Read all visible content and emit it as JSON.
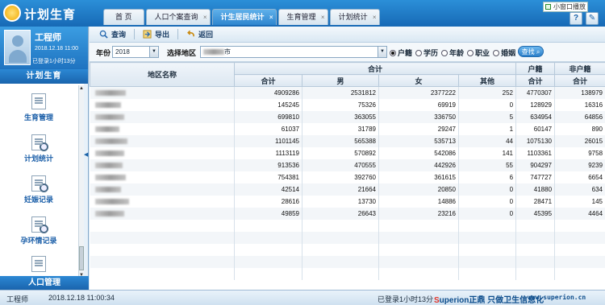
{
  "app": {
    "title": "计划生育"
  },
  "tabs": [
    {
      "label": "首 页",
      "closable": false,
      "active": false
    },
    {
      "label": "人口个案查询",
      "closable": true,
      "active": false
    },
    {
      "label": "计生居民统计",
      "closable": true,
      "active": true
    },
    {
      "label": "生育管理",
      "closable": true,
      "active": false
    },
    {
      "label": "计划统计",
      "closable": true,
      "active": false
    }
  ],
  "tab_close_glyph": "×",
  "popup": {
    "label": "小窗口播放"
  },
  "user": {
    "name": "工程师",
    "datetime": "2018.12.18 11:00",
    "login_duration": "已登录1小时13分"
  },
  "sidebar": {
    "section": "计划生育",
    "items": [
      {
        "label": "生育管理",
        "icon": "document-icon"
      },
      {
        "label": "计划统计",
        "icon": "document-search-icon"
      },
      {
        "label": "妊娠记录",
        "icon": "document-search-icon"
      },
      {
        "label": "孕环情记录",
        "icon": "document-search-icon"
      },
      {
        "label": "",
        "icon": "document-icon"
      }
    ],
    "footer": "人口管理"
  },
  "toolbar": {
    "query": "查询",
    "export": "导出",
    "back": "返回"
  },
  "filter": {
    "year_label": "年份",
    "year_value": "2018",
    "region_label": "选择地区",
    "region_value": "市",
    "radios": [
      {
        "label": "户籍",
        "checked": true
      },
      {
        "label": "学历",
        "checked": false
      },
      {
        "label": "年龄",
        "checked": false
      },
      {
        "label": "职业",
        "checked": false
      },
      {
        "label": "婚姻",
        "checked": false
      }
    ],
    "search_label": "查找"
  },
  "table": {
    "header_region": "地区名称",
    "group_total": "合计",
    "group_huji": "户籍",
    "group_nonhuji": "非户籍",
    "sub": [
      "合计",
      "男",
      "女",
      "其他",
      "合计",
      "合计"
    ],
    "rows": [
      [
        "",
        "4909286",
        "2531812",
        "2377222",
        "252",
        "4770307",
        "138979"
      ],
      [
        "",
        "145245",
        "75326",
        "69919",
        "0",
        "128929",
        "16316"
      ],
      [
        "",
        "699810",
        "363055",
        "336750",
        "5",
        "634954",
        "64856"
      ],
      [
        "",
        "61037",
        "31789",
        "29247",
        "1",
        "60147",
        "890"
      ],
      [
        "",
        "1101145",
        "565388",
        "535713",
        "44",
        "1075130",
        "26015"
      ],
      [
        "",
        "1113119",
        "570892",
        "542086",
        "141",
        "1103361",
        "9758"
      ],
      [
        "",
        "913536",
        "470555",
        "442926",
        "55",
        "904297",
        "9239"
      ],
      [
        "",
        "754381",
        "392760",
        "361615",
        "6",
        "747727",
        "6654"
      ],
      [
        "",
        "42514",
        "21664",
        "20850",
        "0",
        "41880",
        "634"
      ],
      [
        "",
        "28616",
        "13730",
        "14886",
        "0",
        "28471",
        "145"
      ],
      [
        "",
        "49859",
        "26643",
        "23216",
        "0",
        "45395",
        "4464"
      ],
      [
        "",
        "",
        "",
        "",
        "",
        "",
        ""
      ],
      [
        "",
        "",
        "",
        "",
        "",
        "",
        ""
      ],
      [
        "",
        "",
        "",
        "",
        "",
        "",
        ""
      ],
      [
        "",
        "",
        "",
        "",
        "",
        "",
        ""
      ],
      [
        "",
        "",
        "",
        "",
        "",
        "",
        ""
      ]
    ]
  },
  "status": {
    "user": "工程师",
    "datetime": "2018.12.18 11:00:34",
    "login": "已登录1小时13分",
    "brand": "uperion正鼎 只做卫生信息化",
    "url": "www.superion.cn"
  }
}
